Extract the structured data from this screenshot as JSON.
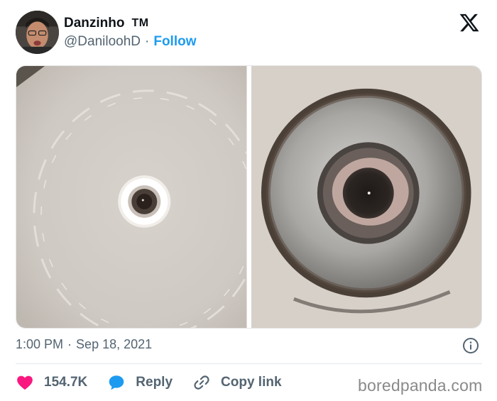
{
  "tweet": {
    "author": {
      "display_name": "Danzinho",
      "badge": "TM",
      "handle": "@DaniloohD",
      "separator": "·",
      "follow_label": "Follow"
    },
    "timestamp": {
      "time": "1:00 PM",
      "separator": "·",
      "date": "Sep 18, 2021"
    },
    "actions": {
      "like_count": "154.7K",
      "reply_label": "Reply",
      "copy_link_label": "Copy link"
    },
    "icons": {
      "platform": "x-logo-icon",
      "info": "info-icon",
      "like": "heart-icon",
      "reply": "speech-bubble-icon",
      "copy_link": "link-icon"
    },
    "colors": {
      "follow": "#1d9bf0",
      "like": "#f91880",
      "reply": "#1d9bf0",
      "secondary_text": "#536471"
    }
  },
  "watermark": "boredpanda.com"
}
